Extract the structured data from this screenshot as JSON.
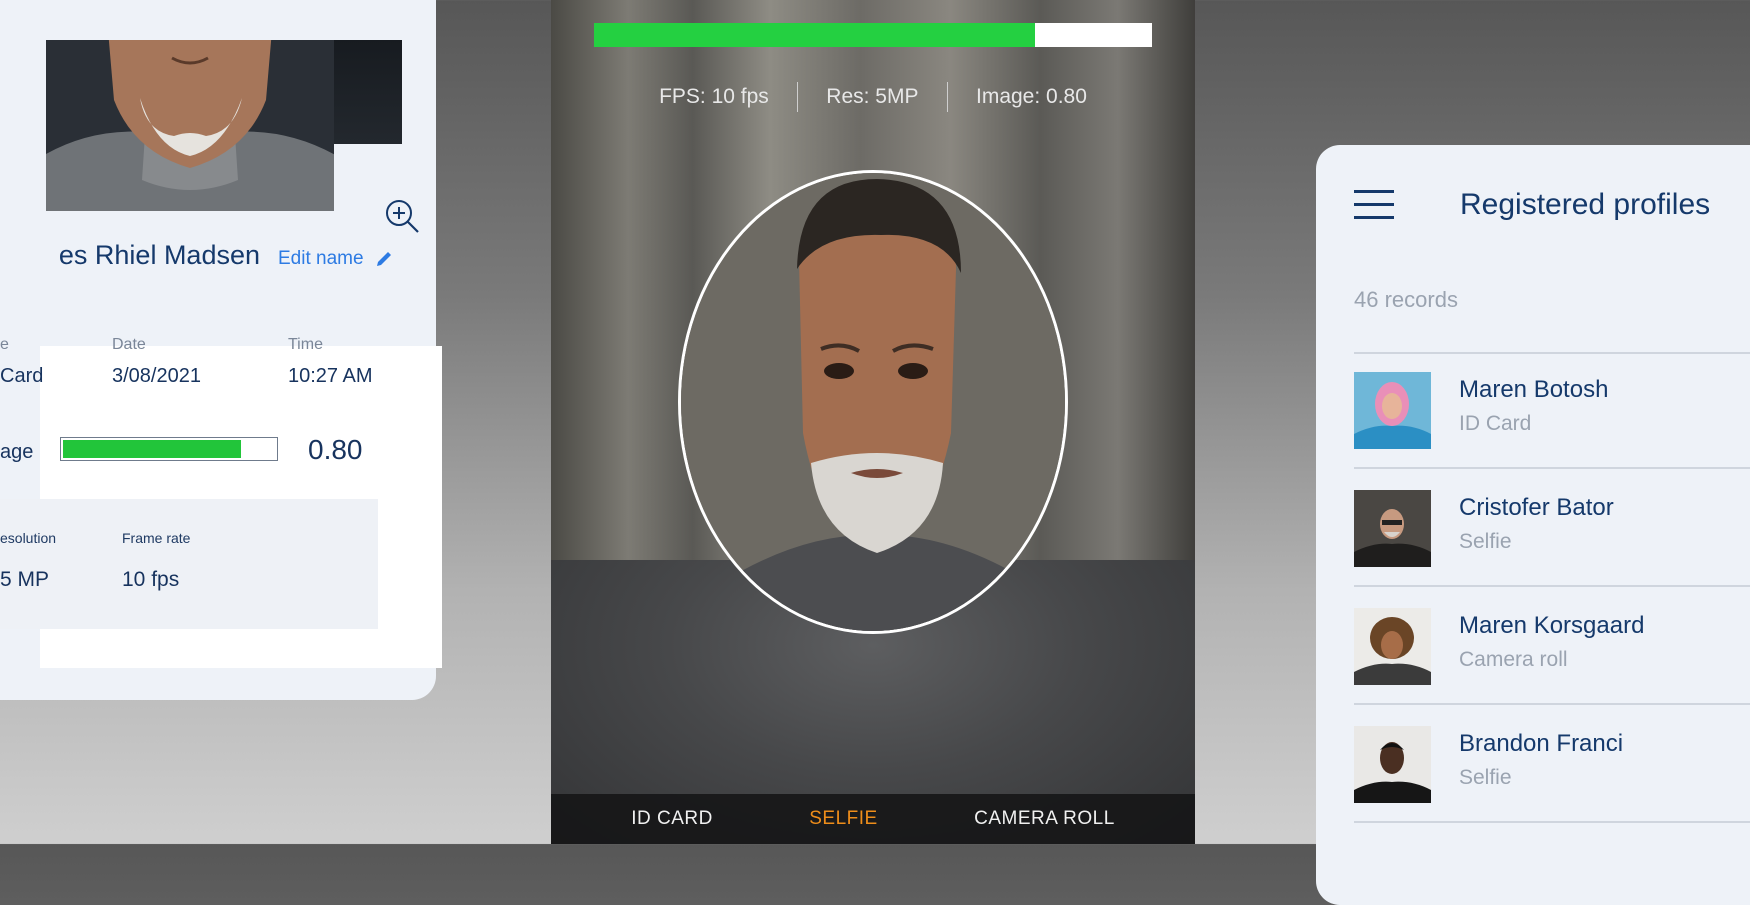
{
  "profile_detail": {
    "name": "es Rhiel Madsen",
    "edit_label": "Edit name",
    "source_label": "e",
    "source_value": "Card",
    "date_label": "Date",
    "date_value": "3/08/2021",
    "time_label": "Time",
    "time_value": "10:27 AM",
    "quality_label": "age",
    "quality_value": "0.80",
    "quality_fill": 0.84,
    "resolution_label": "esolution",
    "resolution_value": "5 MP",
    "framerate_label": "Frame rate",
    "framerate_value": "10 fps"
  },
  "camera": {
    "progress_fill": 0.79,
    "stats": {
      "fps": "FPS: 10 fps",
      "res": "Res: 5MP",
      "image": "Image: 0.80"
    },
    "tabs": [
      {
        "label": "ID CARD",
        "active": false
      },
      {
        "label": "SELFIE",
        "active": true
      },
      {
        "label": "CAMERA ROLL",
        "active": false
      }
    ]
  },
  "profiles": {
    "title": "Registered profiles",
    "record_count": "46 records",
    "items": [
      {
        "name": "Maren Botosh",
        "source": "ID Card"
      },
      {
        "name": "Cristofer Bator",
        "source": "Selfie"
      },
      {
        "name": "Maren Korsgaard",
        "source": "Camera roll"
      },
      {
        "name": "Brandon Franci",
        "source": "Selfie"
      }
    ]
  },
  "colors": {
    "accent_blue": "#2d7be3",
    "navy": "#15396b",
    "progress_green": "#22c53a",
    "active_tab": "#ee8d1a"
  }
}
